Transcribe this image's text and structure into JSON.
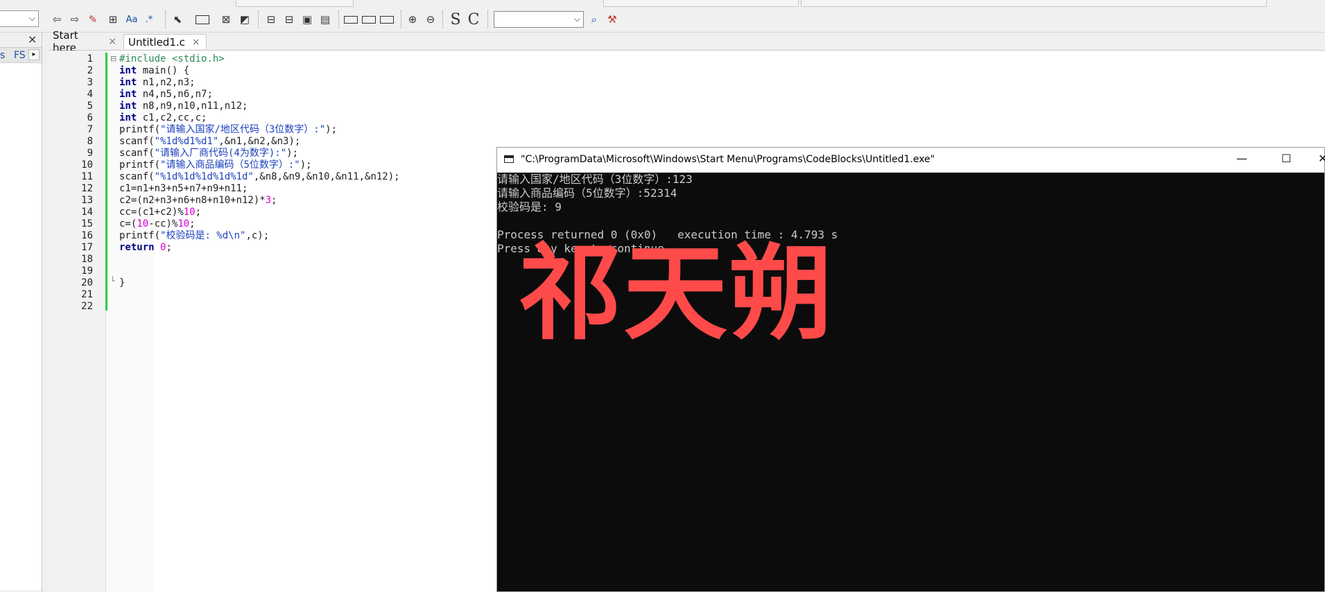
{
  "toolbar": {
    "search_value": "",
    "letter_s": "S",
    "letter_c": "C",
    "aa": "Aa",
    "regex": ".*"
  },
  "left_panel": {
    "close": "×",
    "tab_label": "FS",
    "prev_tab": "s",
    "scroll_arrow": "▸"
  },
  "editor_tabs": [
    {
      "label": "Start here",
      "close": "×"
    },
    {
      "label": "Untitled1.c",
      "close": "×"
    }
  ],
  "code_lines": [
    "#include <stdio.h>",
    "int main() {",
    "int n1,n2,n3;",
    "int n4,n5,n6,n7;",
    "int n8,n9,n10,n11,n12;",
    "int c1,c2,cc,c;",
    "printf(\"请输入国家/地区代码（3位数字）:\");",
    "scanf(\"%1d%d1%d1\",&n1,&n2,&n3);",
    "scanf(\"请输入厂商代码(4为数字):\");",
    "printf(\"请输入商品编码（5位数字）:\");",
    "scanf(\"%1d%1d%1d%1d%1d\",&n8,&n9,&n10,&n11,&n12);",
    "c1=n1+n3+n5+n7+n9+n11;",
    "c2=(n2+n3+n6+n8+n10+n12)*3;",
    "cc=(c1+c2)%10;",
    "c=(10-cc)%10;",
    "printf(\"校验码是: %d\\n\",c);",
    "return 0;",
    "",
    "",
    "}",
    "",
    ""
  ],
  "line_numbers": [
    "1",
    "2",
    "3",
    "4",
    "5",
    "6",
    "7",
    "8",
    "9",
    "10",
    "11",
    "12",
    "13",
    "14",
    "15",
    "16",
    "17",
    "18",
    "19",
    "20",
    "21",
    "22"
  ],
  "console": {
    "title": "\"C:\\ProgramData\\Microsoft\\Windows\\Start Menu\\Programs\\CodeBlocks\\Untitled1.exe\"",
    "minimize": "—",
    "maximize": "☐",
    "close": "✕",
    "lines": [
      "请输入国家/地区代码（3位数字）:123",
      "请输入商品编码（5位数字）:52314",
      "校验码是: 9",
      "",
      "Process returned 0 (0x0)   execution time : 4.793 s",
      "Press any key to continue."
    ],
    "watermark": "祁天朔"
  },
  "colors": {
    "change_bar": "#2ecc40",
    "console_bg": "#0c0c0c",
    "watermark": "#ff4a4a",
    "keyword": "#00008b"
  }
}
